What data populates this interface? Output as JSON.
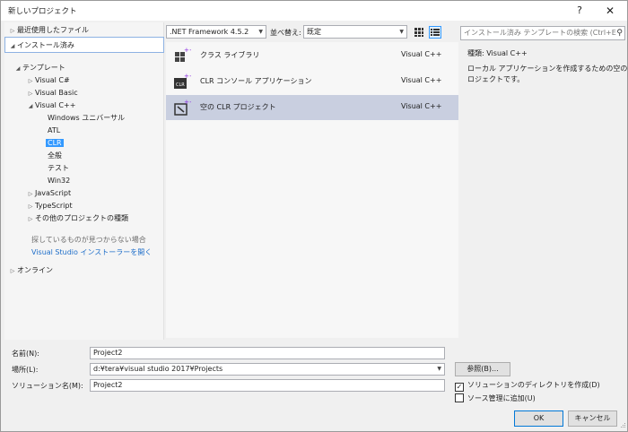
{
  "window": {
    "title": "新しいプロジェクト",
    "help_label": "?",
    "close_label": "✕"
  },
  "tree": {
    "recent": "最近使用したファイル",
    "installed": "インストール済み",
    "templates": "テンプレート",
    "visual_csharp": "Visual C#",
    "visual_basic": "Visual Basic",
    "visual_cpp": "Visual C++",
    "cpp_children": [
      "Windows ユニバーサル",
      "ATL",
      "CLR",
      "全般",
      "テスト",
      "Win32"
    ],
    "javascript": "JavaScript",
    "typescript": "TypeScript",
    "other_types": "その他のプロジェクトの種類",
    "not_found": "探しているものが見つからない場合",
    "open_installer": "Visual Studio インストーラーを開く",
    "online": "オンライン"
  },
  "toolbar": {
    "framework": ".NET Framework 4.5.2",
    "sort_label": "並べ替え:",
    "sort_value": "既定"
  },
  "templates": [
    {
      "name": "クラス ライブラリ",
      "lang": "Visual C++",
      "icon": "class-library-icon"
    },
    {
      "name": "CLR コンソール アプリケーション",
      "lang": "Visual C++",
      "icon": "clr-console-icon"
    },
    {
      "name": "空の CLR プロジェクト",
      "lang": "Visual C++",
      "icon": "empty-clr-icon"
    }
  ],
  "details": {
    "search_placeholder": "インストール済み テンプレートの検索 (Ctrl+E",
    "type_label": "種類:",
    "type_value": "Visual C++",
    "description_line1": "ローカル アプリケーションを作成するための空のプ",
    "description_line2": "ロジェクトです。"
  },
  "form": {
    "name_label": "名前(N):",
    "name_value": "Project2",
    "location_label": "場所(L):",
    "location_value": "d:¥tera¥visual studio 2017¥Projects",
    "solution_label": "ソリューション名(M):",
    "solution_value": "Project2",
    "browse": "参照(B)...",
    "create_dir": "ソリューションのディレクトリを作成(D)",
    "create_dir_checked": true,
    "add_source_control": "ソース管理に追加(U)",
    "add_source_control_checked": false,
    "ok": "OK",
    "cancel": "キャンセル"
  },
  "colors": {
    "selection": "#3399ff",
    "link": "#1e6ec9",
    "selected_row": "#c9cfe0"
  }
}
